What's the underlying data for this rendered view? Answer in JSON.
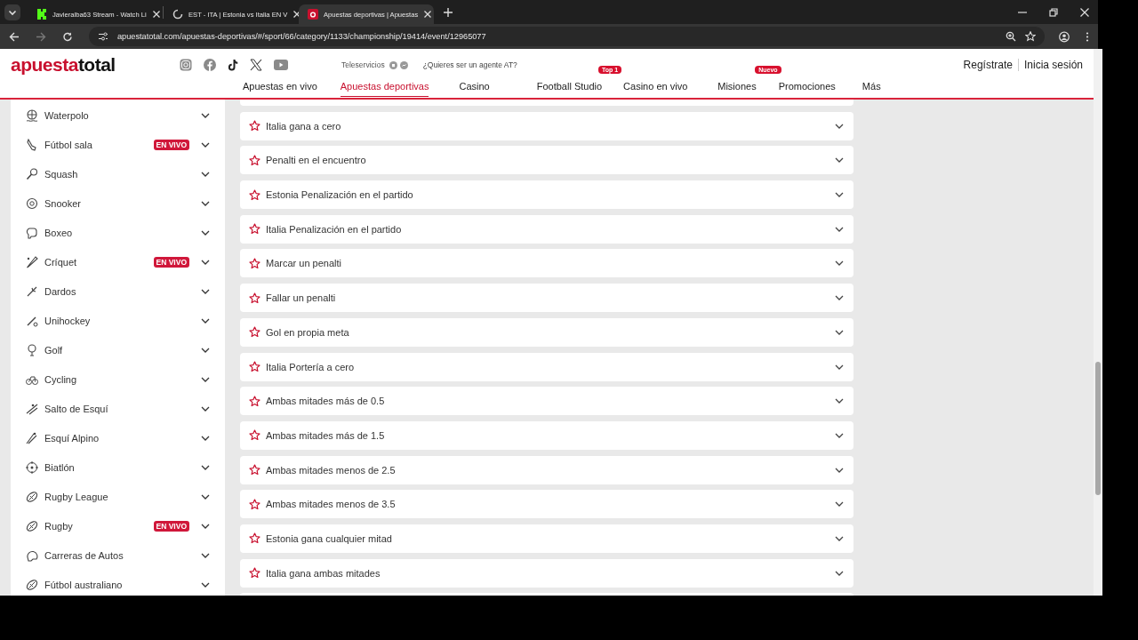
{
  "browser": {
    "tabs": [
      {
        "title": "Javieralba63 Stream - Watch Li",
        "selected": false
      },
      {
        "title": "EST - ITA | Estonia vs Italia EN V",
        "selected": false
      },
      {
        "title": "Apuestas deportivas | Apuestas",
        "selected": true
      }
    ],
    "url": "apuestatotal.com/apuestas-deportivas/#/sport/66/category/1133/championship/19414/event/12965077"
  },
  "header": {
    "logo": {
      "first": "apuesta",
      "second": "total"
    },
    "teleservicios": "Teleservicios",
    "agent_link": "¿Quieres ser un agente AT?",
    "nav": [
      {
        "label": "Apuestas en vivo",
        "selected": false
      },
      {
        "label": "Apuestas deportivas",
        "selected": true
      },
      {
        "label": "Casino",
        "selected": false
      },
      {
        "label": "Football Studio",
        "selected": false,
        "badge": "Top 1"
      },
      {
        "label": "Casino en vivo",
        "selected": false
      },
      {
        "label": "Misiones",
        "selected": false,
        "badge": "Nuevo"
      },
      {
        "label": "Promociones",
        "selected": false
      },
      {
        "label": "Más",
        "selected": false
      }
    ],
    "register": "Regístrate",
    "login": "Inicia sesión"
  },
  "sidebar": {
    "items": [
      {
        "name": "Waterpolo"
      },
      {
        "name": "Fútbol sala",
        "badge": "EN VIVO"
      },
      {
        "name": "Squash"
      },
      {
        "name": "Snooker"
      },
      {
        "name": "Boxeo"
      },
      {
        "name": "Críquet",
        "badge": "EN VIVO"
      },
      {
        "name": "Dardos"
      },
      {
        "name": "Unihockey"
      },
      {
        "name": "Golf"
      },
      {
        "name": "Cycling"
      },
      {
        "name": "Salto de Esquí"
      },
      {
        "name": "Esquí Alpino"
      },
      {
        "name": "Biatlón"
      },
      {
        "name": "Rugby League"
      },
      {
        "name": "Rugby",
        "badge": "EN VIVO"
      },
      {
        "name": "Carreras de Autos"
      },
      {
        "name": "Fútbol australiano"
      }
    ]
  },
  "markets": [
    "Italia gana a cero",
    "Penalti en el encuentro",
    "Estonia Penalización en el partido",
    "Italia Penalización en el partido",
    "Marcar un penalti",
    "Fallar un penalti",
    "Gol en propia meta",
    "Italia Portería a cero",
    "Ambas mitades más de 0.5",
    "Ambas mitades más de 1.5",
    "Ambas mitades menos de 2.5",
    "Ambas mitades menos de 3.5",
    "Estonia gana cualquier mitad",
    "Italia gana ambas mitades"
  ]
}
